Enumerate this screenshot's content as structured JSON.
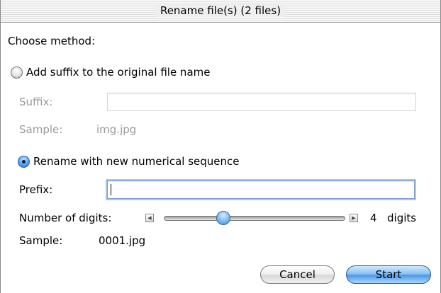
{
  "window": {
    "title": "Rename file(s) (2 files)"
  },
  "method_label": "Choose method:",
  "suffix_option": {
    "label": "Add suffix to the original file name",
    "selected": false,
    "suffix_label": "Suffix:",
    "suffix_value": "",
    "sample_label": "Sample:",
    "sample_value": "img.jpg"
  },
  "sequence_option": {
    "label": "Rename with new numerical sequence",
    "selected": true,
    "prefix_label": "Prefix:",
    "prefix_value": "",
    "digits_label": "Number of digits:",
    "digits_value": "4",
    "digits_unit": "digits",
    "digits_slider_fraction": 0.33,
    "sample_label": "Sample:",
    "sample_value": "0001.jpg"
  },
  "buttons": {
    "cancel": "Cancel",
    "start": "Start"
  },
  "colors": {
    "accent": "#5aa4ec",
    "disabled_text": "#9a9a9a",
    "focus_ring": "#a9c8ee"
  },
  "icons": {
    "slider_decrease": "triangle-left-icon",
    "slider_increase": "triangle-right-icon"
  }
}
